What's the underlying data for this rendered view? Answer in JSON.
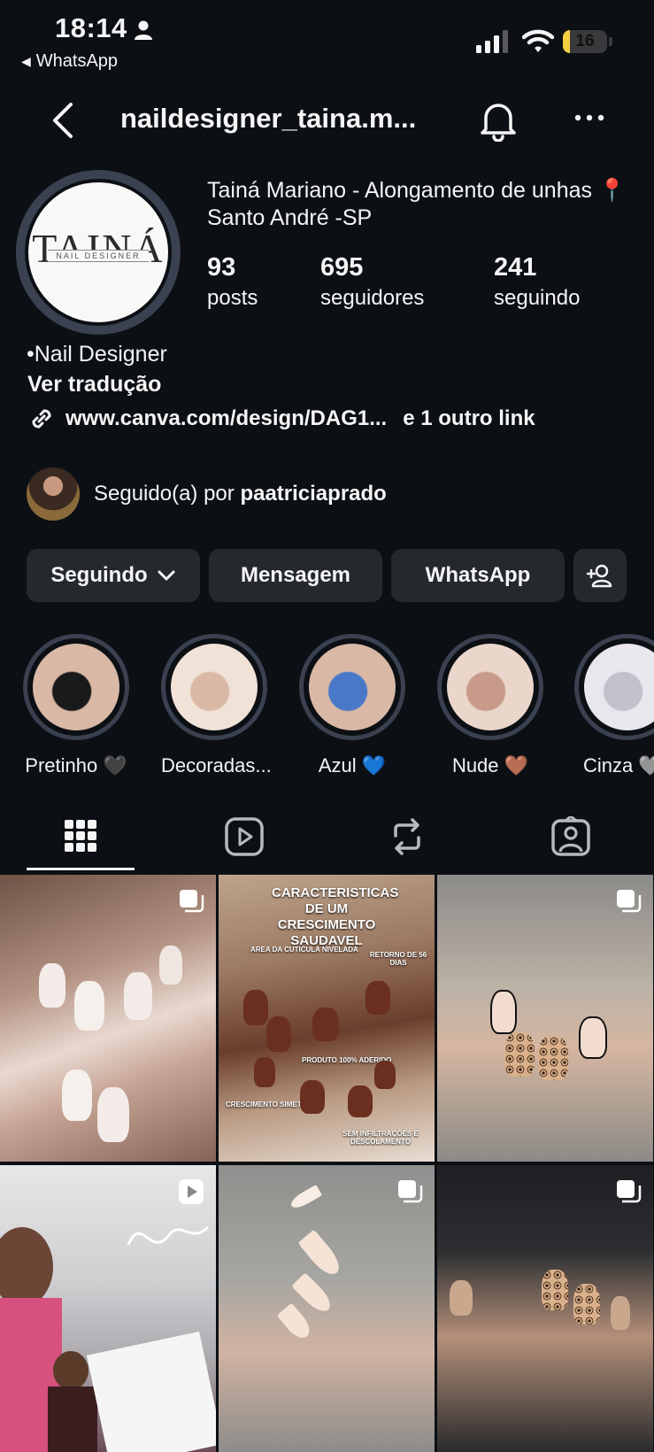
{
  "status_bar": {
    "time": "18:14",
    "back_app": "WhatsApp",
    "battery": "16",
    "battery_level": 0.16
  },
  "header": {
    "username": "naildesigner_taina.m..."
  },
  "profile": {
    "avatar_logo_main": "TAINÁ",
    "avatar_logo_sub": "NAIL DESIGNER",
    "full_name": "Tainá Mariano - Alongamento de unhas 📍 Santo André -SP",
    "stats": [
      {
        "value": "93",
        "label": "posts"
      },
      {
        "value": "695",
        "label": "seguidores"
      },
      {
        "value": "241",
        "label": "seguindo"
      }
    ],
    "bio_line": "•Nail Designer",
    "translate": "Ver tradução",
    "link": "www.canva.com/design/DAG1...",
    "extra_link": "e 1 outro link",
    "followed_prefix": "Seguido(a) por",
    "followed_by": "paatriciaprado"
  },
  "actions": {
    "following": "Seguindo",
    "message": "Mensagem",
    "whatsapp": "WhatsApp"
  },
  "highlights": [
    {
      "label": "Pretinho 🖤",
      "colors": [
        "#1a1a1a",
        "#d9b9a6"
      ]
    },
    {
      "label": "Decoradas...",
      "colors": [
        "#d9b9a6",
        "#f1e2d8"
      ]
    },
    {
      "label": "Azul 💙",
      "colors": [
        "#4a78c9",
        "#d9b9a6"
      ]
    },
    {
      "label": "Nude 🤎",
      "colors": [
        "#c79a8a",
        "#ead6ca"
      ]
    },
    {
      "label": "Cinza 🩶",
      "colors": [
        "#c3c0cc",
        "#e9e6ee"
      ]
    }
  ],
  "tabs": [
    {
      "name": "grid"
    },
    {
      "name": "reels"
    },
    {
      "name": "reposts"
    },
    {
      "name": "tagged"
    }
  ],
  "posts": [
    {
      "type": "carousel"
    },
    {
      "type": "image",
      "caption_top": "CARACTERISTICAS DE UM CRESCIMENTO SAUDAVEL",
      "annotations": [
        "AREA DA CUTICULA NIVELADA",
        "RETORNO DE 56 DIAS",
        "PRODUTO 100% ADERIDO",
        "CRESCIMENTO SIMETRICO",
        "SEM INFILTRAÇÕES E DESCOLAMENTO"
      ]
    },
    {
      "type": "carousel"
    },
    {
      "type": "reel"
    },
    {
      "type": "carousel"
    },
    {
      "type": "carousel"
    }
  ],
  "colors": {
    "background": "#0c1014",
    "button": "#25292e",
    "ring": "#3a4150"
  }
}
